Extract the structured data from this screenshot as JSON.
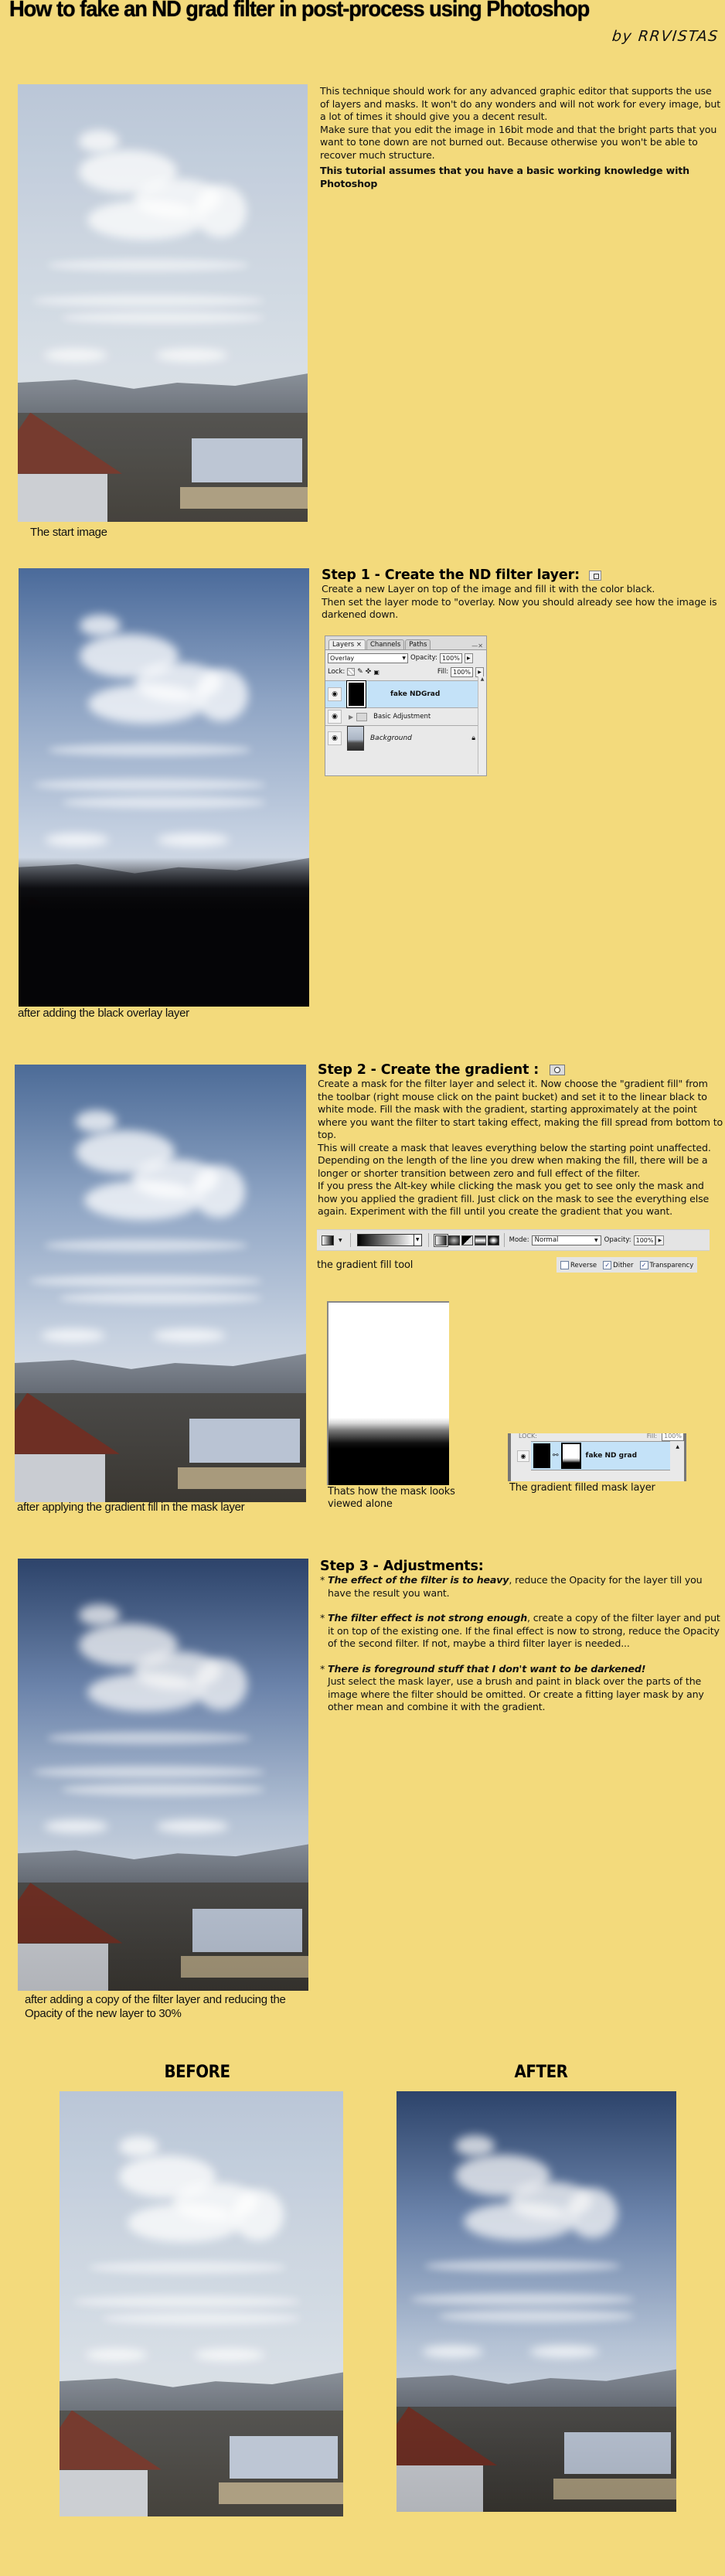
{
  "header": {
    "title": "How to fake an ND grad filter in post-process using Photoshop",
    "byline": "by RRVISTAS"
  },
  "intro": {
    "paragraph_1": "This technique should work for any advanced graphic editor that supports the use of layers and masks.  It won't do any wonders and will not work for every image, but a lot of times it should give you a decent result.",
    "paragraph_2": "Make sure that you edit the image in 16bit mode and that the bright parts that you want to tone down are not burned out. Because otherwise you won't be able to recover much structure.",
    "note": "This tutorial assumes that you have a basic working knowledge with Photoshop",
    "image_caption": "The start image"
  },
  "step1": {
    "title": "Step 1 - Create the ND filter layer:",
    "icon": "new-layer-icon",
    "text_1": "Create a new Layer on top of the image and fill it with the color black.",
    "text_2": "Then set the layer mode to \"overlay. Now you should already see how the image is darkened down.",
    "image_caption": "after adding the black overlay layer",
    "layers_panel": {
      "tabs": [
        "Layers ×",
        "Channels",
        "Paths"
      ],
      "blend_mode": "Overlay",
      "opacity_label": "Opacity:",
      "opacity_value": "100%",
      "lock_label": "Lock:",
      "fill_label": "Fill:",
      "fill_value": "100%",
      "layers": [
        {
          "name": "fake NDGrad",
          "selected": true
        },
        {
          "name": "Basic Adjustment",
          "type": "group"
        },
        {
          "name": "Background",
          "locked": true
        }
      ]
    }
  },
  "step2": {
    "title": "Step 2 - Create the gradient :",
    "icon": "add-mask-icon",
    "text_1": "Create a mask for the filter layer and select it. Now choose the \"gradient fill\" from the toolbar (right mouse click on the paint bucket) and set it to the linear black to white mode. Fill the mask with the gradient, starting approximately at the point where you want the filter to start taking effect, making the fill spread from bottom to top.",
    "text_2": "This will create a mask that leaves everything below the starting point unaffected. Depending on the length of the line you drew when making the fill, there will be a longer or shorter transition between zero and full effect of the filter.",
    "text_3": "If you press the Alt-key while clicking the mask you get to see only the mask and how you applied the gradient fill. Just click on the mask to see the everything else again. Experiment with the fill until  you create the  gradient that you want.",
    "toolbar": {
      "mode_label": "Mode:",
      "mode_value": "Normal",
      "opacity_label": "Opacity:",
      "opacity_value": "100%",
      "reverse_label": "Reverse",
      "reverse_checked": false,
      "dither_label": "Dither",
      "dither_checked": true,
      "transparency_label": "Transparency",
      "transparency_checked": true
    },
    "toolbar_caption": "the gradient fill tool",
    "mask_caption": "Thats how the mask looks viewed alone",
    "mask_layer_name": "fake ND grad",
    "mask_layer_fill_value": "100%",
    "mask_layer_caption": "The gradient filled mask layer",
    "image_caption": "after applying the gradient fill in the mask layer"
  },
  "step3": {
    "title": "Step 3 - Adjustments:",
    "items": [
      {
        "bullet": "*",
        "heading": "The effect of the filter is to heavy",
        "text": ", reduce the Opacity for the layer till you have the result you want."
      },
      {
        "bullet": "*",
        "heading": "The filter effect is not strong enough",
        "text": ", create a copy of the filter layer and put it on top of the existing one. If the final effect is now to strong, reduce the Opacity of the second filter. If not, maybe a third filter layer is needed..."
      },
      {
        "bullet": "*",
        "heading": "There is foreground stuff that I don't want to be darkened!",
        "text": "Just select the mask layer, use a brush and paint in black over the parts of the image where the filter should be omitted. Or create a fitting layer mask by any other mean and combine it with the gradient."
      }
    ],
    "image_caption": "after adding a copy of the filter layer and reducing the Opacity of the new layer to 30%"
  },
  "comparison": {
    "before_label": "BEFORE",
    "after_label": "AFTER"
  },
  "colors": {
    "background": "#f3da7c",
    "selected_layer": "#c4e2f8"
  }
}
